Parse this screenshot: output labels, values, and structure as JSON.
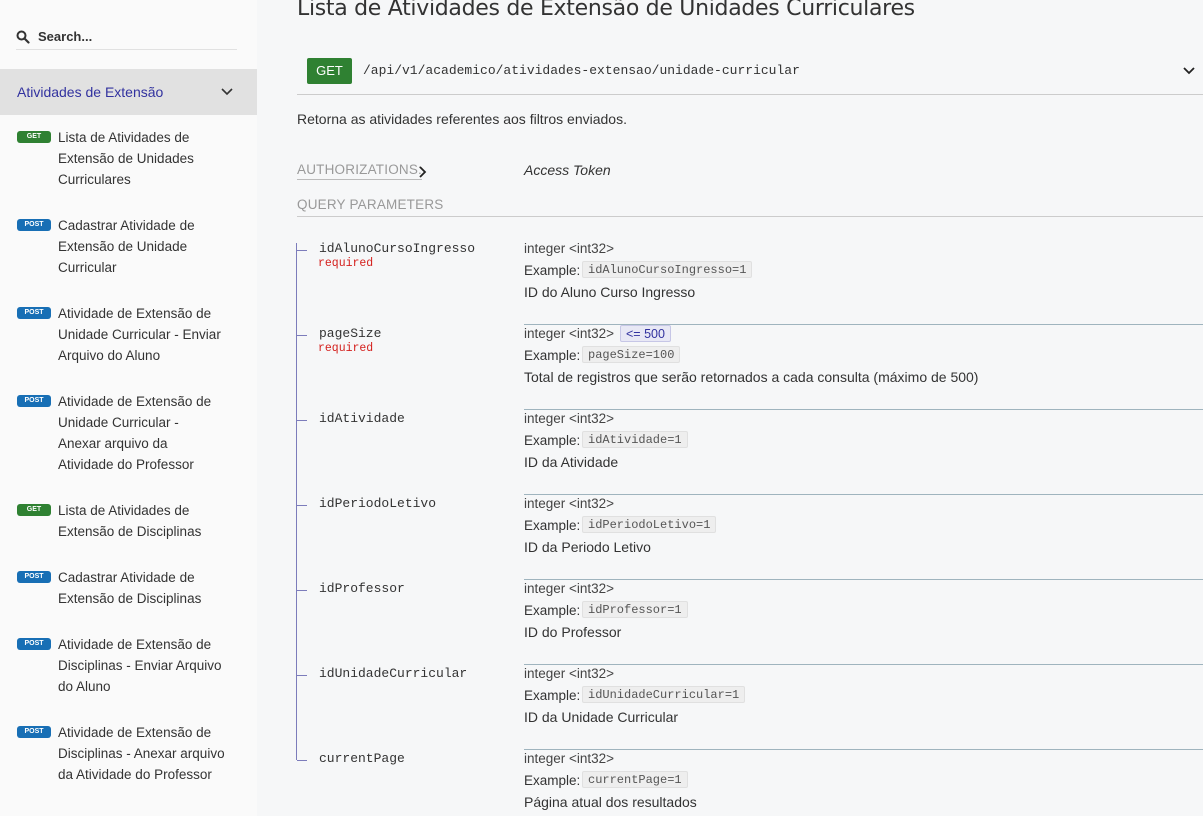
{
  "search": {
    "placeholder": "Search..."
  },
  "sidebar": {
    "group_label": "Atividades de Extensão",
    "items": [
      {
        "method": "GET",
        "lines": [
          "Lista de Atividades de",
          "Extensão de Unidades",
          "Curriculares"
        ]
      },
      {
        "method": "POST",
        "lines": [
          "Cadastrar Atividade de",
          "Extensão de Unidade",
          "Curricular"
        ]
      },
      {
        "method": "POST",
        "lines": [
          "Atividade de Extensão de",
          "Unidade Curricular - Enviar",
          "Arquivo do Aluno"
        ]
      },
      {
        "method": "POST",
        "lines": [
          "Atividade de Extensão de",
          "Unidade Curricular -",
          "Anexar arquivo da",
          "Atividade do Professor"
        ]
      },
      {
        "method": "GET",
        "lines": [
          "Lista de Atividades de",
          "Extensão de Disciplinas"
        ]
      },
      {
        "method": "POST",
        "lines": [
          "Cadastrar Atividade de",
          "Extensão de Disciplinas"
        ]
      },
      {
        "method": "POST",
        "lines": [
          "Atividade de Extensão de",
          "Disciplinas - Enviar Arquivo",
          "do Aluno"
        ]
      },
      {
        "method": "POST",
        "lines": [
          "Atividade de Extensão de",
          "Disciplinas - Anexar arquivo",
          "da Atividade do Professor"
        ]
      }
    ]
  },
  "main": {
    "title": "Lista de Atividades de Extensão de Unidades Curriculares",
    "method": "GET",
    "path": "/api/v1/academico/atividades-extensao/unidade-curricular",
    "description": "Retorna as atividades referentes aos filtros enviados.",
    "auth_label": "AUTHORIZATIONS:",
    "auth_value": "Access Token",
    "query_label": "QUERY PARAMETERS",
    "example_label": "Example:",
    "required_label": "required",
    "params": [
      {
        "name": "idAlunoCursoIngresso",
        "required": true,
        "type": "integer <int32>",
        "limit": "",
        "example": "idAlunoCursoIngresso=1",
        "description": "ID do Aluno Curso Ingresso"
      },
      {
        "name": "pageSize",
        "required": true,
        "type": "integer <int32>",
        "limit": "<= 500",
        "example": "pageSize=100",
        "description": "Total de registros que serão retornados a cada consulta (máximo de 500)"
      },
      {
        "name": "idAtividade",
        "required": false,
        "type": "integer <int32>",
        "limit": "",
        "example": "idAtividade=1",
        "description": "ID da Atividade"
      },
      {
        "name": "idPeriodoLetivo",
        "required": false,
        "type": "integer <int32>",
        "limit": "",
        "example": "idPeriodoLetivo=1",
        "description": "ID da Periodo Letivo"
      },
      {
        "name": "idProfessor",
        "required": false,
        "type": "integer <int32>",
        "limit": "",
        "example": "idProfessor=1",
        "description": "ID do Professor"
      },
      {
        "name": "idUnidadeCurricular",
        "required": false,
        "type": "integer <int32>",
        "limit": "",
        "example": "idUnidadeCurricular=1",
        "description": "ID da Unidade Curricular"
      },
      {
        "name": "currentPage",
        "required": false,
        "type": "integer <int32>",
        "limit": "",
        "example": "currentPage=1",
        "description": "Página atual dos resultados"
      }
    ]
  },
  "colors": {
    "get": "#2f8132",
    "post": "#186fb5",
    "accent": "#32329f",
    "required": "#d41f1c"
  }
}
